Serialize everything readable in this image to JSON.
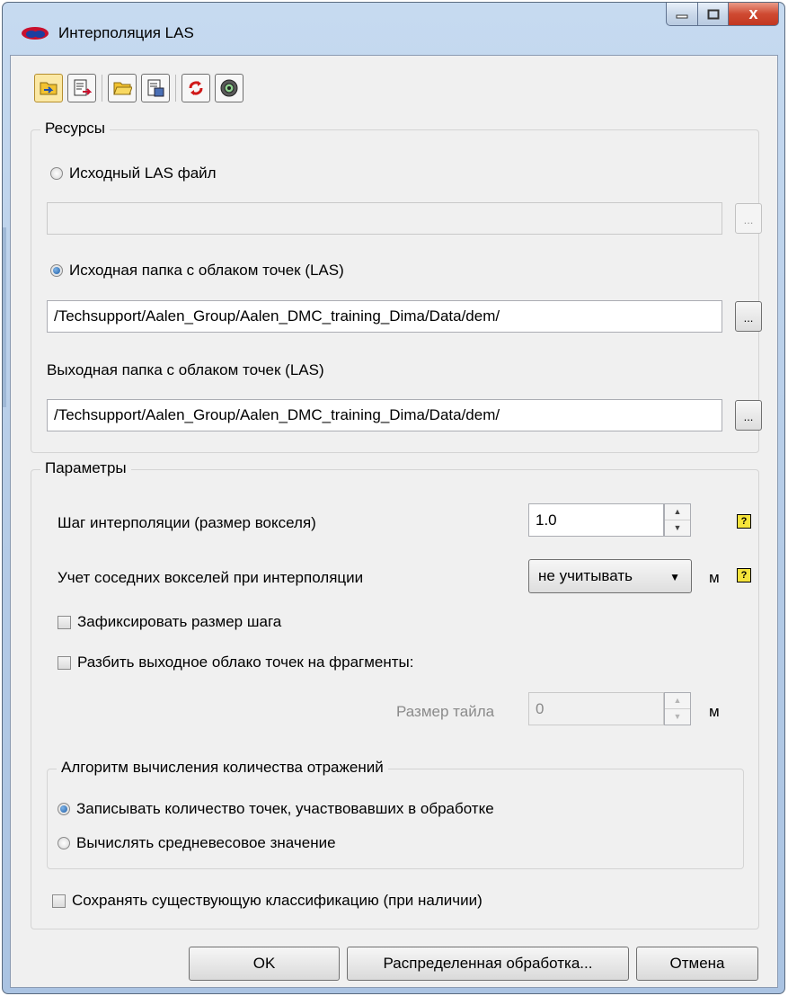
{
  "window": {
    "title": "Интерполяция LAS",
    "close_glyph": "x"
  },
  "toolbar": {
    "buttons": [
      {
        "icon": "load-settings-icon",
        "active": true
      },
      {
        "icon": "save-settings-icon",
        "active": false
      },
      {
        "icon": "open-folder-icon",
        "active": false
      },
      {
        "icon": "save-as-icon",
        "active": false
      },
      {
        "icon": "reset-icon",
        "active": false
      },
      {
        "icon": "default-settings-icon",
        "active": false
      }
    ]
  },
  "resources": {
    "group_title": "Ресурсы",
    "source_file_label": "Исходный LAS файл",
    "source_file_value": "",
    "source_folder_label": "Исходная папка с облаком точек (LAS)",
    "source_folder_value": "/Techsupport/Aalen_Group/Aalen_DMC_training_Dima/Data/dem/",
    "output_folder_label": "Выходная папка с облаком точек (LAS)",
    "output_folder_value": "/Techsupport/Aalen_Group/Aalen_DMC_training_Dima/Data/dem/",
    "browse_label": "...",
    "selected": "source_folder"
  },
  "parameters": {
    "group_title": "Параметры",
    "step_label": "Шаг интерполяции (размер вокселя)",
    "step_value": "1.0",
    "neighbors_label": "Учет соседних вокселей при интерполяции",
    "neighbors_selected": "не учитывать",
    "neighbors_unit": "м",
    "fix_step_label": "Зафиксировать размер шага",
    "fix_step_checked": false,
    "split_label": "Разбить выходное облако точек на фрагменты:",
    "split_checked": false,
    "tile_size_label": "Размер тайла",
    "tile_size_value": "0",
    "tile_size_unit": "м",
    "help_glyph": "?"
  },
  "algorithm": {
    "group_title": "Алгоритм вычисления количества отражений",
    "option_count_label": "Записывать количество точек, участвовавших в обработке",
    "option_weighted_label": "Вычислять средневесовое значение",
    "selected": "count"
  },
  "keep_classification_label": "Сохранять существующую классификацию (при наличии)",
  "keep_classification_checked": false,
  "buttons": {
    "ok": "OK",
    "distributed": "Распределенная обработка...",
    "cancel": "Отмена"
  },
  "colors": {
    "title_bar": "#b9cfe8",
    "dialog_bg": "#f0f0f0",
    "close_button": "#c84630",
    "help_icon": "#f5e33b"
  }
}
